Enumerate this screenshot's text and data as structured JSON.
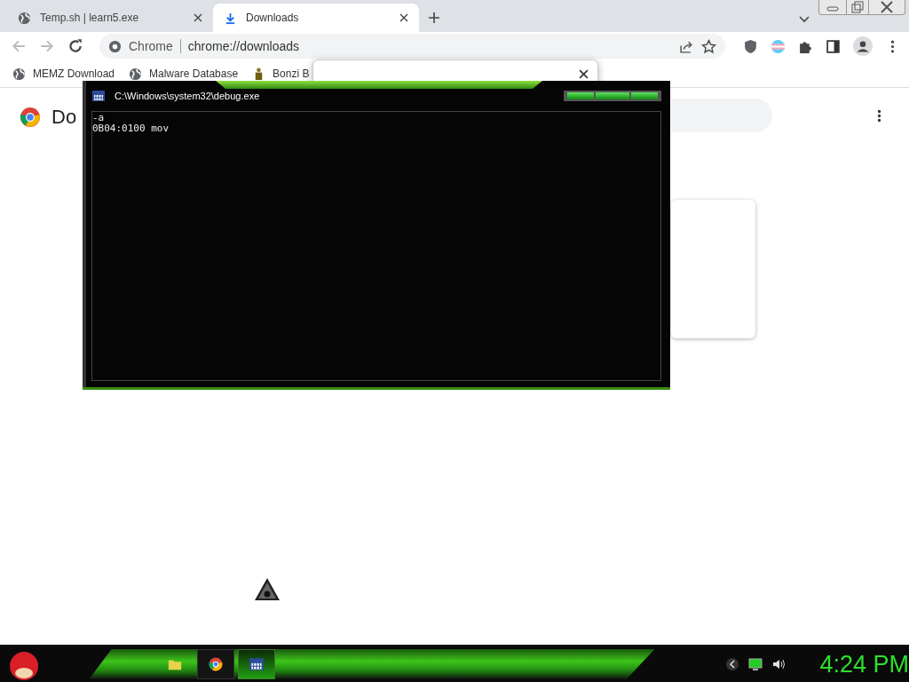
{
  "browser": {
    "tabs": [
      {
        "title": "Temp.sh | learn5.exe",
        "selected": false,
        "kind": "globe"
      },
      {
        "title": "Downloads",
        "selected": true,
        "kind": "download"
      }
    ],
    "address": {
      "site": "Chrome",
      "url": "chrome://downloads"
    },
    "bookmarks": [
      {
        "label": "MEMZ Download",
        "kind": "globe"
      },
      {
        "label": "Malware Database",
        "kind": "globe"
      },
      {
        "label": "Bonzi B",
        "kind": "figure"
      }
    ],
    "page": {
      "heading": "Do"
    }
  },
  "console": {
    "title": "C:\\Windows\\system32\\debug.exe",
    "lines": [
      "-a",
      "0B04:0100 mov"
    ]
  },
  "taskbar": {
    "items": [
      {
        "kind": "folder",
        "selected": false
      },
      {
        "kind": "chrome",
        "selected": false
      },
      {
        "kind": "console",
        "selected": true
      }
    ],
    "clock": "4:24 PM"
  }
}
